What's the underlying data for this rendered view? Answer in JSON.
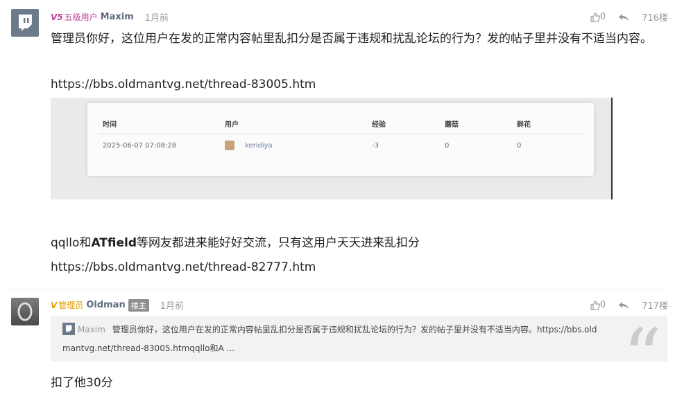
{
  "posts": [
    {
      "level": "五级用户",
      "level_badge": "V5",
      "user": "Maxim",
      "time": "1月前",
      "likes": "0",
      "floor": "716楼",
      "text1": "管理员你好，这位用户在发的正常内容帖里乱扣分是否属于违规和扰乱论坛的行为？发的帖子里并没有不适当内容。",
      "link1": "https://bbs.oldmantvg.net/thread-83005.htm",
      "text2_pre": "qqllo和",
      "text2_bold": "ATfield",
      "text2_post": "等网友都进来能好好交流，只有这用户天天进来乱扣分",
      "link2": "https://bbs.oldmantvg.net/thread-82777.htm",
      "screenshot": {
        "headers": [
          "时间",
          "用户",
          "经验",
          "蘑菇",
          "鲜花"
        ],
        "row": [
          "2025-06-07 07:08:28",
          "keridiya",
          "-3",
          "0",
          "0"
        ]
      }
    },
    {
      "level": "管理员",
      "level_badge": "V",
      "user": "Oldman",
      "tag": "楼主",
      "time": "1月前",
      "likes": "0",
      "floor": "717楼",
      "quote_user": "Maxim",
      "quote_text": "管理员你好，这位用户在发的正常内容帖里乱扣分是否属于违规和扰乱论坛的行为？发的帖子里并没有不适当内容。https://bbs.old",
      "quote_text2": "mantvg.net/thread-83005.htmqqllo和A ...",
      "reply": "扣了他30分"
    }
  ],
  "colors": {
    "level5": "#c2409b",
    "admin": "#e0a000",
    "twitch": "#6c7a8c"
  }
}
